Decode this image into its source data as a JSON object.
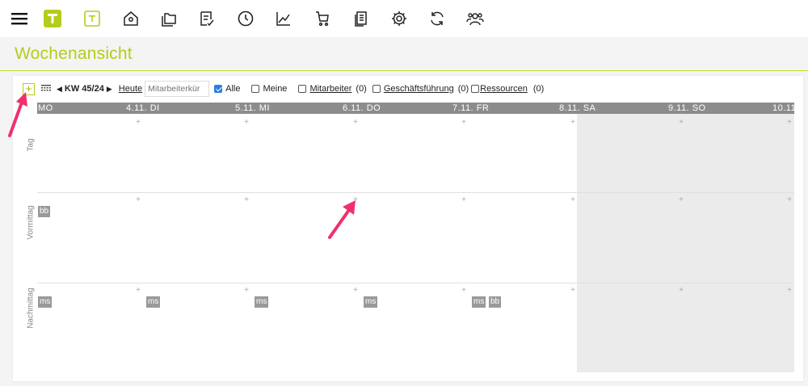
{
  "nav": {
    "icons": [
      "menu-icon",
      "logo-t-icon",
      "template-t-icon",
      "home-location-icon",
      "folders-icon",
      "checklist-icon",
      "clock-icon",
      "chart-icon",
      "cart-icon",
      "documents-icon",
      "gear-icon",
      "refresh-icon",
      "users-icon"
    ],
    "accent": "#b5cc1a"
  },
  "page": {
    "title": "Wochenansicht"
  },
  "toolbar": {
    "add_label": "+",
    "week_label": "KW 45/24",
    "today_label": "Heute",
    "employee_placeholder": "Mitarbeiterkür",
    "filters": [
      {
        "label": "Alle",
        "checked": true,
        "count": ""
      },
      {
        "label": "Meine",
        "checked": false,
        "count": ""
      },
      {
        "label": "Mitarbeiter",
        "checked": false,
        "count": "(0)"
      },
      {
        "label": "Geschäftsführung",
        "checked": false,
        "count": "(0)"
      },
      {
        "label": "Ressourcen",
        "checked": false,
        "count": "(0)"
      }
    ]
  },
  "calendar": {
    "days": [
      "MO",
      "4.11. DI",
      "5.11. MI",
      "6.11. DO",
      "7.11. FR",
      "8.11. SA",
      "9.11. SO",
      "10.11."
    ],
    "rows": [
      "Tag",
      "Vormittag",
      "Nachmittag"
    ],
    "plus_label": "+",
    "entries": {
      "vormittag_mo": "bb",
      "nachmittag_mo": "ms",
      "nachmittag_di": "ms",
      "nachmittag_mi": "ms",
      "nachmittag_do": "ms",
      "nachmittag_fr_1": "ms",
      "nachmittag_fr_2": "bb"
    },
    "colors": {
      "header": "#8c8c8c",
      "weekend": "#ebebeb",
      "chip": "#999999"
    }
  },
  "annotations": {
    "arrow_color": "#f0306a"
  }
}
